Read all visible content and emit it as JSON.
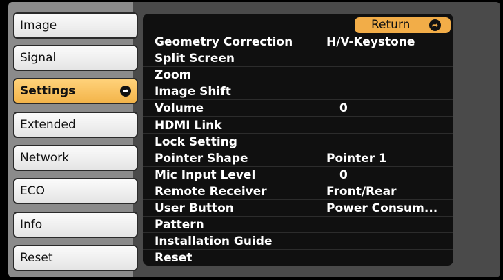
{
  "menu": {
    "tabs": [
      {
        "label": "Image"
      },
      {
        "label": "Signal"
      },
      {
        "label": "Settings"
      },
      {
        "label": "Extended"
      },
      {
        "label": "Network"
      },
      {
        "label": "ECO"
      },
      {
        "label": "Info"
      },
      {
        "label": "Reset"
      }
    ],
    "active_tab": "Settings"
  },
  "panel": {
    "return_label": "Return",
    "items": [
      {
        "label": "Geometry Correction",
        "value": "H/V-Keystone"
      },
      {
        "label": "Split Screen",
        "value": ""
      },
      {
        "label": "Zoom",
        "value": ""
      },
      {
        "label": "Image Shift",
        "value": ""
      },
      {
        "label": "Volume",
        "value": "0"
      },
      {
        "label": "HDMI Link",
        "value": ""
      },
      {
        "label": "Lock Setting",
        "value": ""
      },
      {
        "label": "Pointer Shape",
        "value": "Pointer 1"
      },
      {
        "label": "Mic Input Level",
        "value": "0"
      },
      {
        "label": "Remote Receiver",
        "value": "Front/Rear"
      },
      {
        "label": "User Button",
        "value": "Power Consum..."
      },
      {
        "label": "Pattern",
        "value": ""
      },
      {
        "label": "Installation Guide",
        "value": ""
      },
      {
        "label": "Reset",
        "value": ""
      }
    ]
  },
  "colors": {
    "accent": "#f2ad48",
    "tab_active": "#f3b44a",
    "panel_bg": "#101010"
  },
  "icons": {
    "tab_active": "enter-icon",
    "return": "enter-icon"
  }
}
